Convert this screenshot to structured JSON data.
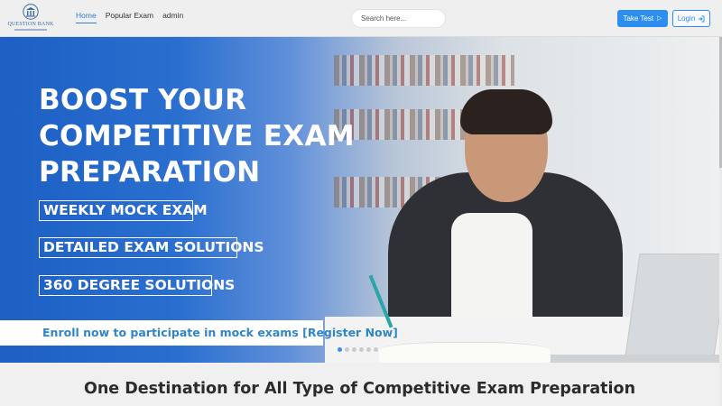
{
  "logo": {
    "text": "QUESTION BANK",
    "icon": "bank-building-icon"
  },
  "nav": {
    "links": [
      {
        "label": "Home",
        "active": true
      },
      {
        "label": "Popular Exam",
        "active": false
      },
      {
        "label": "admin",
        "active": false
      }
    ]
  },
  "search": {
    "placeholder": "Search here..."
  },
  "buttons": {
    "take_test": {
      "label": "Take Test",
      "icon": "play-icon"
    },
    "login": {
      "label": "Login",
      "icon": "sign-in-icon"
    }
  },
  "hero": {
    "headline": [
      "BOOST YOUR",
      "COMPETITIVE EXAM",
      "PREPARATION"
    ],
    "tags": [
      "WEEKLY MOCK EXAM",
      "DETAILED EXAM SOLUTIONS",
      "360 DEGREE SOLUTIONS"
    ],
    "enroll_text": "Enroll now to participate in mock exams [Register Now]",
    "slides": 6,
    "active_slide": 1
  },
  "section": {
    "title": "One Destination for All Type of Competitive Exam Preparation"
  },
  "colors": {
    "accent": "#2e8ef0",
    "hero_blue": "#1d5fc4",
    "enroll_text": "#2f86c6"
  }
}
